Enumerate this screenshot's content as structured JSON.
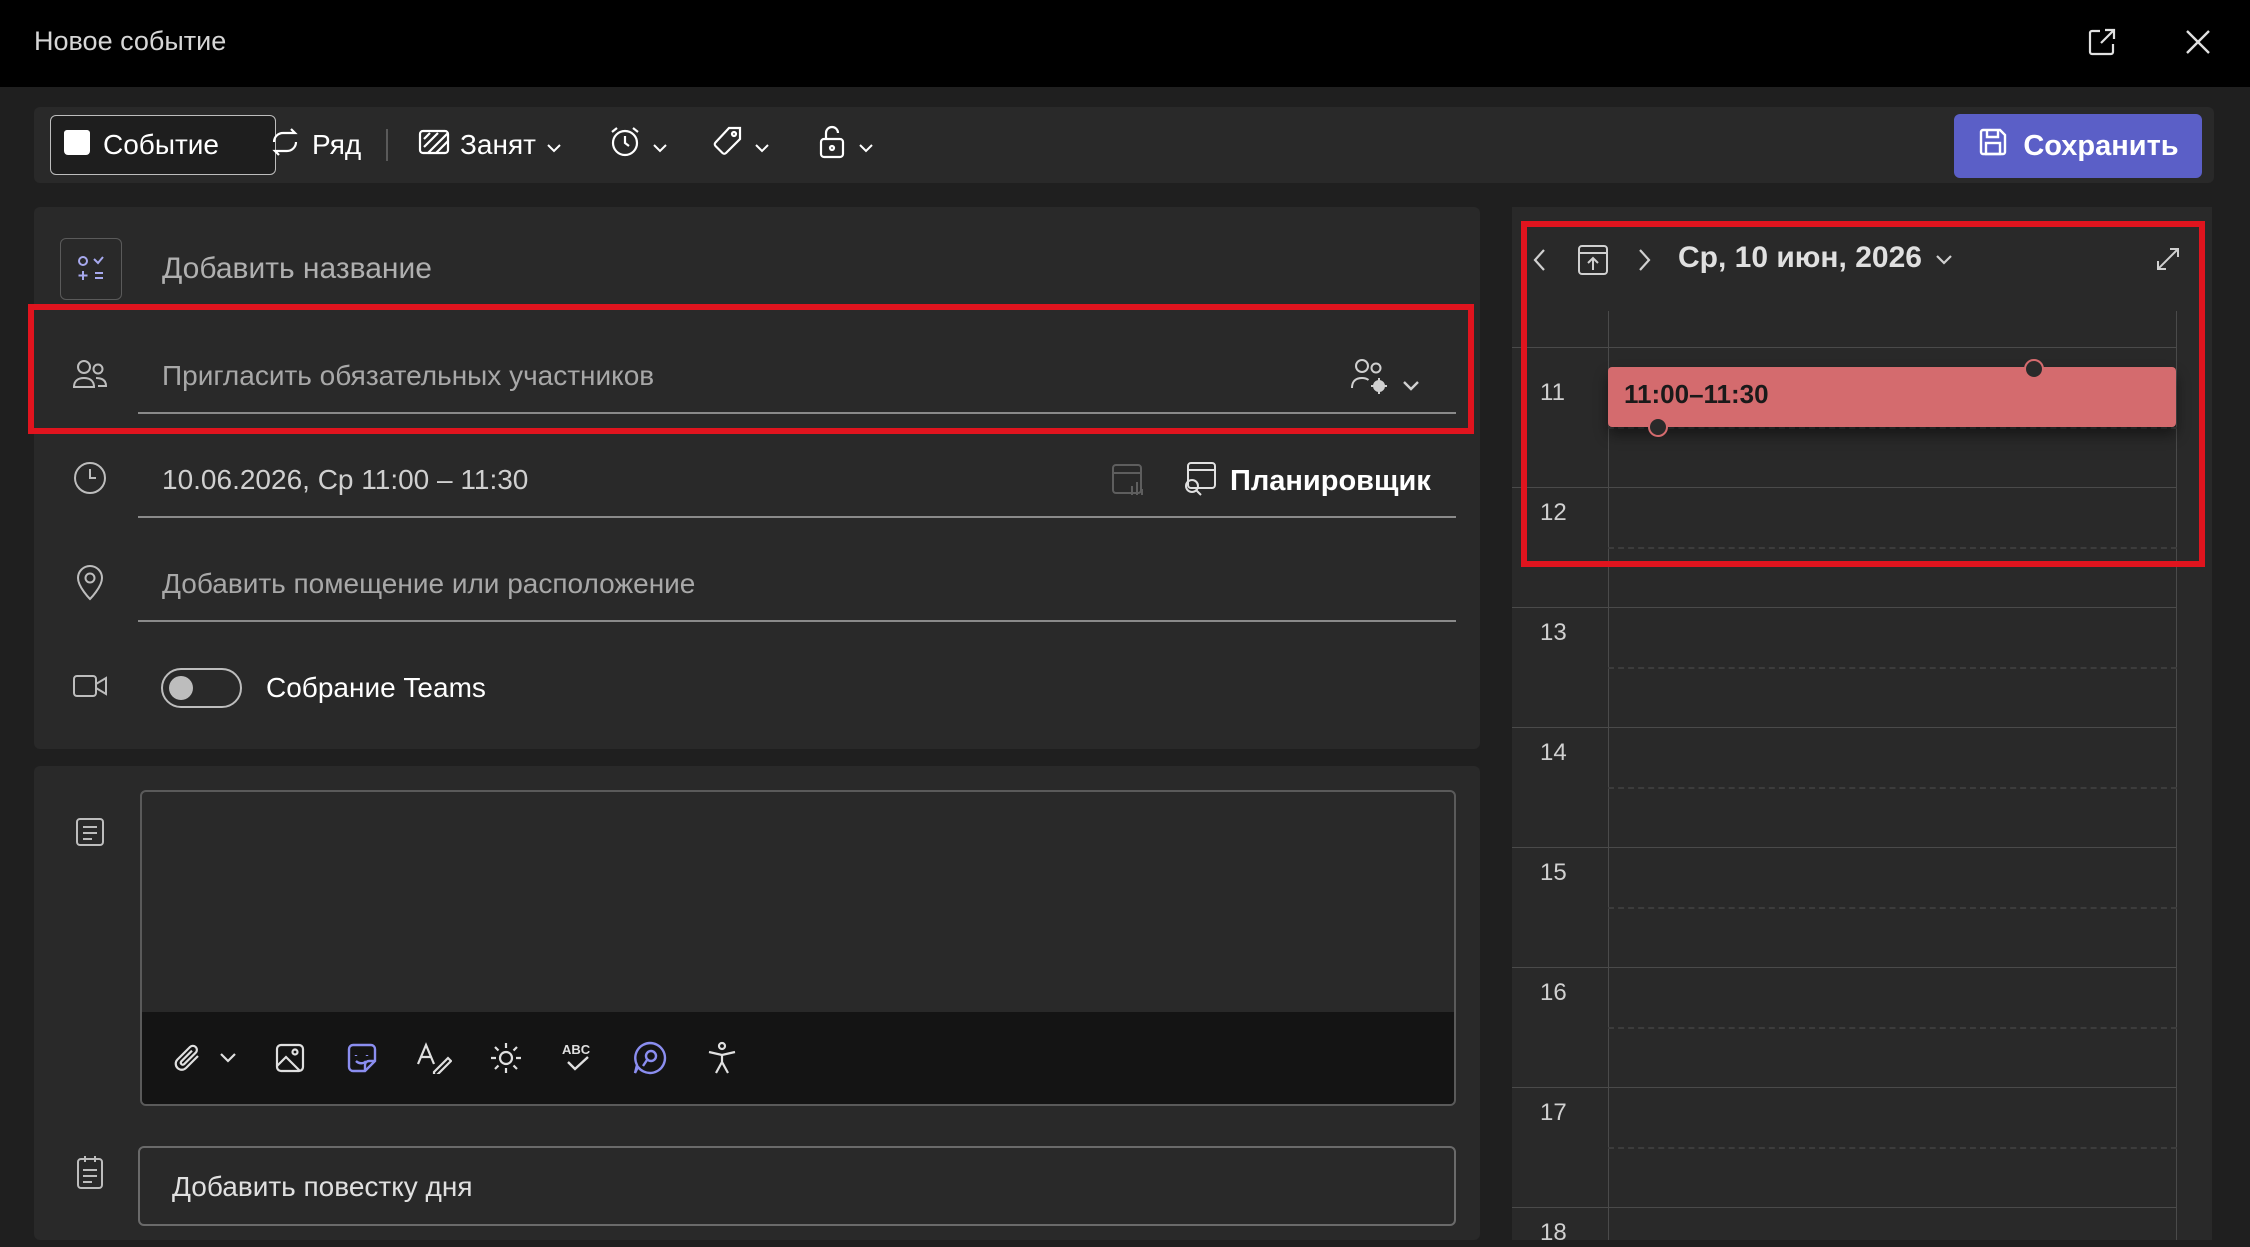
{
  "window": {
    "title": "Новое событие"
  },
  "toolbar": {
    "event_label": "Событие",
    "series_label": "Ряд",
    "status_label": "Занят",
    "save_label": "Сохранить"
  },
  "form": {
    "title_placeholder": "Добавить название",
    "attendees_placeholder": "Пригласить обязательных участников",
    "datetime_value": "10.06.2026, Ср 11:00 – 11:30",
    "scheduler_label": "Планировщик",
    "location_placeholder": "Добавить помещение или расположение",
    "teams_label": "Собрание Teams",
    "agenda_label": "Добавить повестку дня"
  },
  "calendar": {
    "date_label": "Ср, 10 июн, 2026",
    "hours": [
      "11",
      "12",
      "13",
      "14",
      "15",
      "16",
      "17",
      "18"
    ],
    "event_time": "11:00–11:30"
  },
  "colors": {
    "accent": "#5b5fc7",
    "event": "#d46b6e",
    "highlight": "#e0141e"
  },
  "icons": [
    "external-window-icon",
    "close-icon",
    "calendar-icon",
    "repeat-icon",
    "busy-status-icon",
    "alarm-icon",
    "tag-icon",
    "lock-icon",
    "save-icon",
    "category-icon",
    "people-icon",
    "people-settings-icon",
    "clock-icon",
    "scheduler-icon",
    "location-icon",
    "video-icon",
    "notes-icon",
    "attach-icon",
    "image-icon",
    "sticker-icon",
    "format-text-icon",
    "sun-icon",
    "spellcheck-icon",
    "copilot-icon",
    "accessibility-icon",
    "agenda-icon",
    "chevron-left-icon",
    "chevron-right-icon",
    "today-icon",
    "expand-icon"
  ]
}
